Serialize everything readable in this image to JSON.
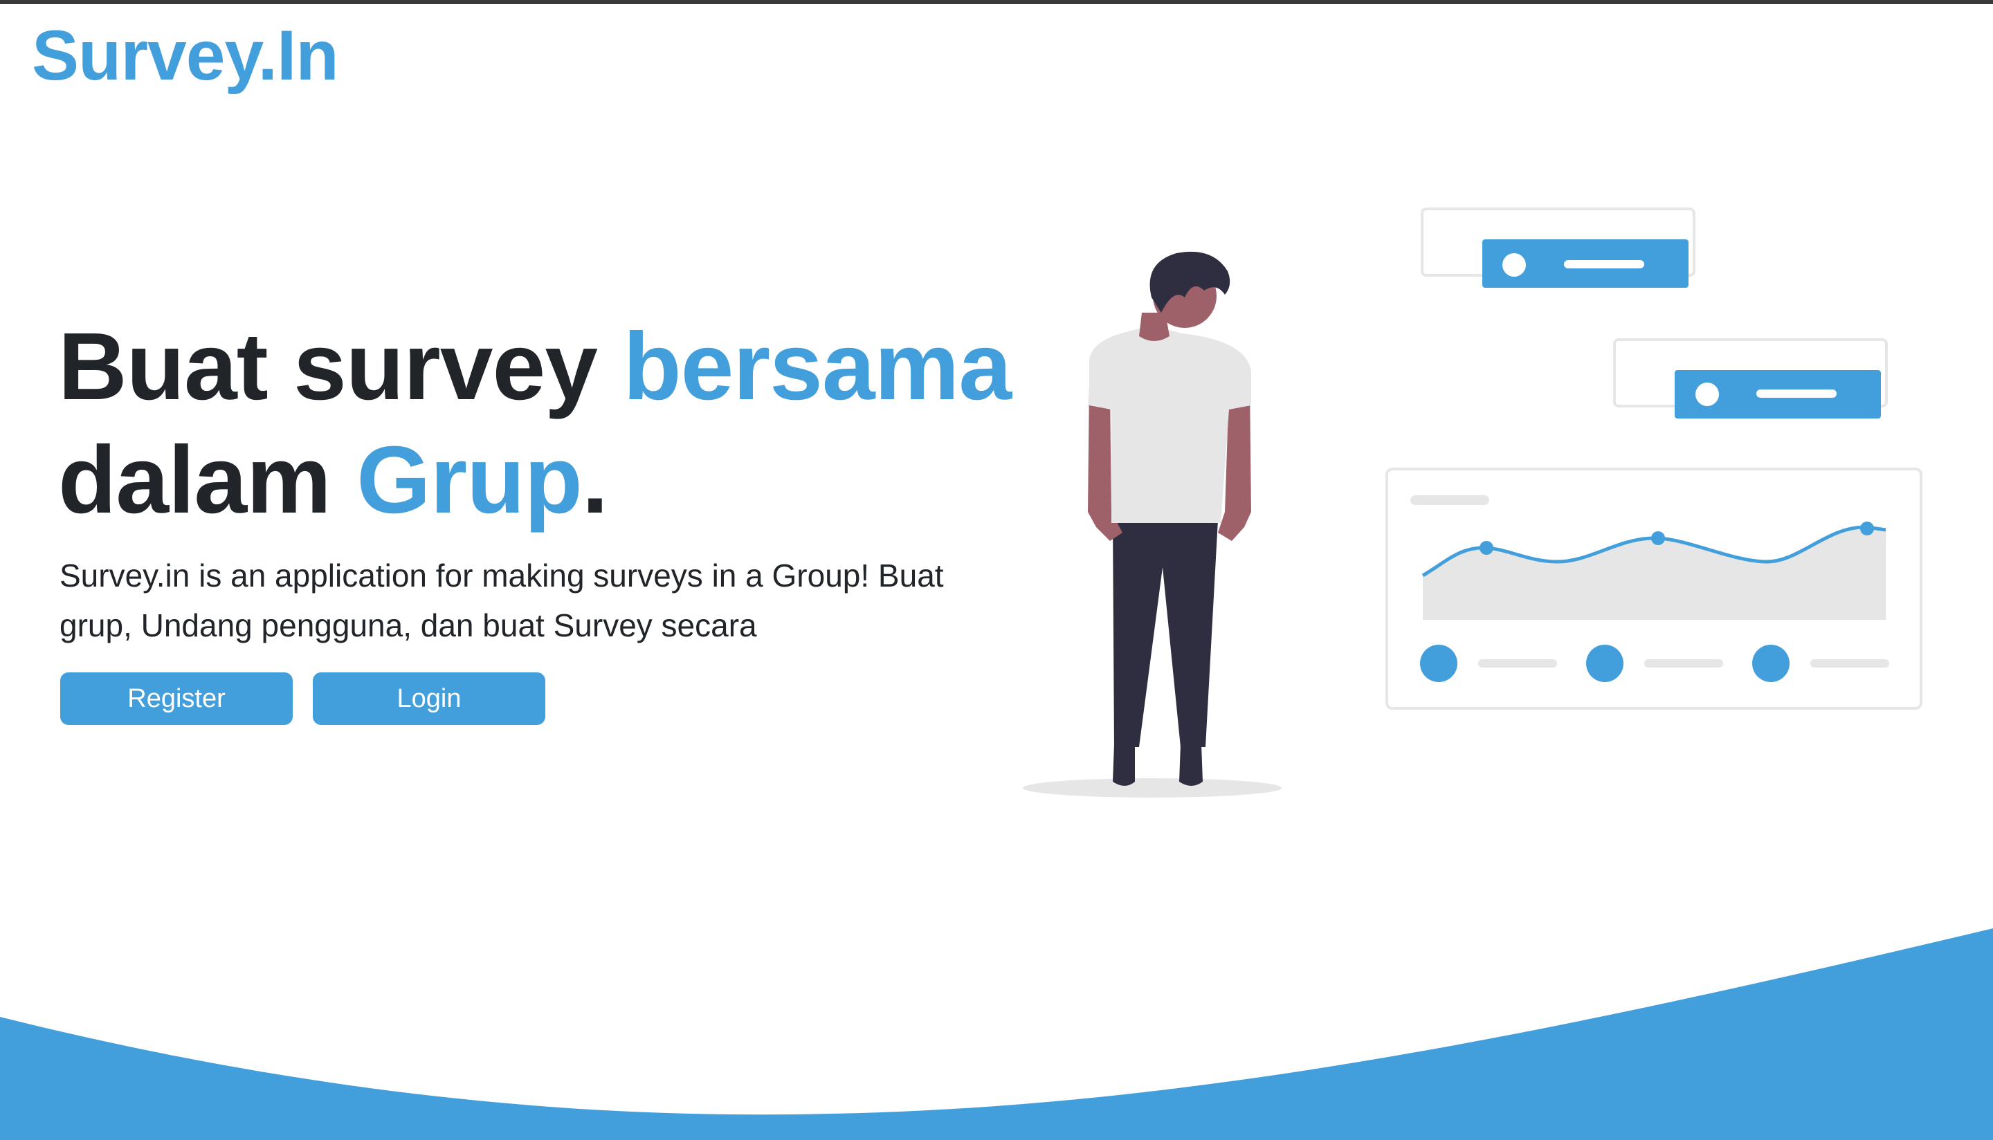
{
  "brand": {
    "logo_text": "Survey.In"
  },
  "hero": {
    "title_part1": "Buat survey ",
    "title_accent1": "bersama",
    "title_part2": "dalam ",
    "title_accent2": "Grup",
    "title_end": ".",
    "description": "Survey.in is an application for making surveys in a Group! Buat grup, Undang pengguna, dan buat Survey secara"
  },
  "actions": {
    "register_label": "Register",
    "login_label": "Login"
  },
  "colors": {
    "accent": "#439fdb",
    "text_dark": "#212429",
    "illustration_gray": "#e6e6e6",
    "person_skin": "#9e616a",
    "person_dark": "#2f2e41"
  }
}
